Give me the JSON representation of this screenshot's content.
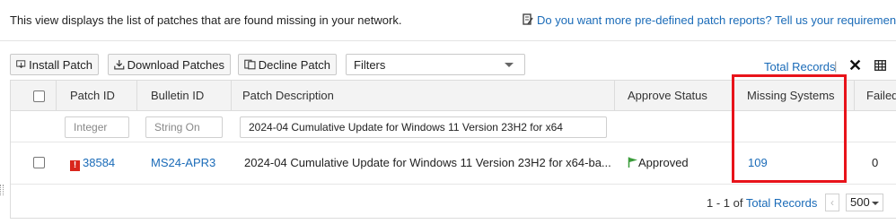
{
  "info": {
    "description": "This view displays the list of patches that are found missing in your network.",
    "feedback_link": "Do you want more pre-defined patch reports? Tell us your requirements"
  },
  "toolbar": {
    "install_label": "Install Patch",
    "download_label": "Download Patches",
    "decline_label": "Decline Patch",
    "filters_label": "Filters",
    "total_records_label": "Total Records",
    "separator": "|"
  },
  "table": {
    "columns": {
      "patch_id": "Patch ID",
      "bulletin_id": "Bulletin ID",
      "description": "Patch Description",
      "approve_status": "Approve Status",
      "missing_systems": "Missing Systems",
      "failed": "Failed"
    },
    "filters": {
      "patch_id_placeholder": "Integer",
      "bulletin_id_placeholder": "String On",
      "description_value": "2024-04 Cumulative Update for Windows 11 Version 23H2 for x64"
    },
    "rows": [
      {
        "patch_id": "38584",
        "bulletin_id": "MS24-APR3",
        "description": "2024-04 Cumulative Update for Windows 11 Version 23H2 for x64-ba...",
        "approve_status": "Approved",
        "missing_systems": "109",
        "failed": "0",
        "severity_marker": "!"
      }
    ]
  },
  "pager": {
    "range": "1 - 1 of",
    "total_records_label": "Total Records",
    "prev": "‹",
    "page_size": "500"
  },
  "colors": {
    "link": "#1a6bb8",
    "highlight": "#e8131a",
    "approved_flag": "#3a9c3a",
    "severity": "#d9261c"
  },
  "icons": {
    "feedback": "edit-note-icon",
    "install": "install-icon",
    "download": "download-icon",
    "decline": "decline-icon",
    "close": "close-icon",
    "columns": "grid-icon",
    "flag": "flag-icon"
  }
}
